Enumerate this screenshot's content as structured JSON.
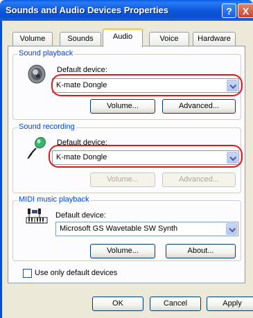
{
  "window": {
    "title": "Sounds and Audio Devices Properties"
  },
  "title_buttons": {
    "help": "?",
    "close": "X"
  },
  "tabs": [
    {
      "label": "Volume",
      "active": false
    },
    {
      "label": "Sounds",
      "active": false
    },
    {
      "label": "Audio",
      "active": true
    },
    {
      "label": "Voice",
      "active": false
    },
    {
      "label": "Hardware",
      "active": false
    }
  ],
  "playback": {
    "legend": "Sound playback",
    "device_label": "Default device:",
    "selected": "K-mate Dongle",
    "volume_button": "Volume...",
    "advanced_button": "Advanced..."
  },
  "recording": {
    "legend": "Sound recording",
    "device_label": "Default device:",
    "selected": "K-mate Dongle",
    "volume_button": "Volume...",
    "advanced_button": "Advanced..."
  },
  "midi": {
    "legend": "MIDI music playback",
    "device_label": "Default device:",
    "selected": "Microsoft GS Wavetable SW Synth",
    "volume_button": "Volume...",
    "about_button": "About..."
  },
  "default_only": {
    "label": "Use only default devices",
    "checked": false
  },
  "footer": {
    "ok": "OK",
    "cancel": "Cancel",
    "apply": "Apply"
  },
  "colors": {
    "title_bar": "#0a5ee6",
    "highlight_ring": "#e01818",
    "group_legend": "#0046d5"
  },
  "icons": {
    "playback": "speaker-icon",
    "recording": "microphone-icon",
    "midi": "midi-keyboard-icon"
  }
}
